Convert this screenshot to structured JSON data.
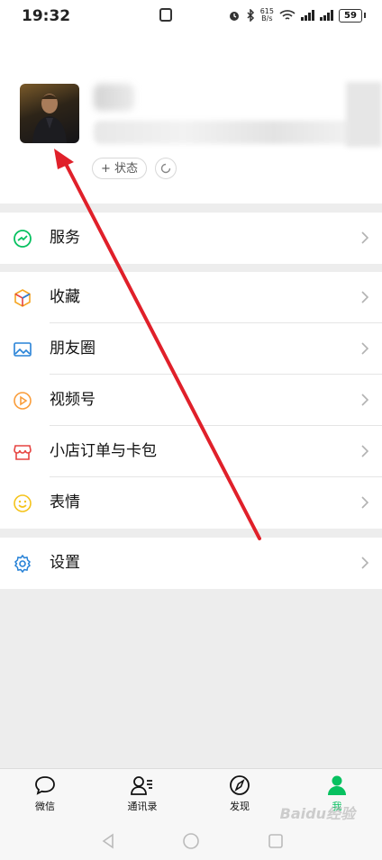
{
  "status_bar": {
    "time": "19:32",
    "net_speed_value": "615",
    "net_speed_unit": "B/s",
    "battery": "59"
  },
  "profile": {
    "status_button_label": "+ 状态"
  },
  "menu": {
    "service": "服务",
    "favorites": "收藏",
    "moments": "朋友圈",
    "channels": "视频号",
    "orders_cards": "小店订单与卡包",
    "stickers": "表情",
    "settings": "设置"
  },
  "tabs": [
    {
      "label": "微信"
    },
    {
      "label": "通讯录"
    },
    {
      "label": "发现"
    },
    {
      "label": "我"
    }
  ],
  "watermark": "Baidu经验",
  "colors": {
    "accent_green": "#07c160",
    "annotation_red": "#e0202a"
  }
}
